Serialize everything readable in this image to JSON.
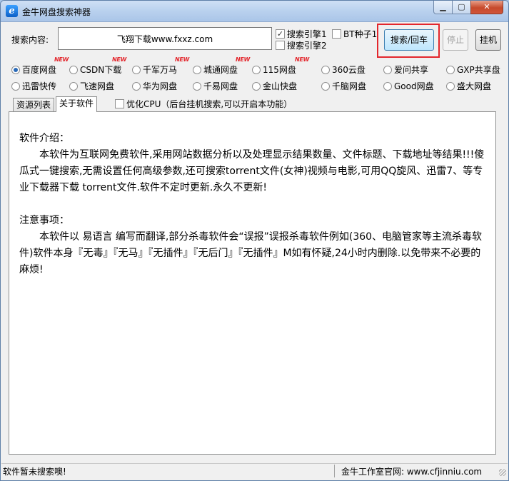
{
  "window": {
    "title": "金牛网盘搜索神器",
    "icon": "ie-logo-icon"
  },
  "search": {
    "label": "搜索内容:",
    "value": "飞翔下载www.fxxz.com",
    "engines": [
      {
        "label": "搜索引擎1",
        "checked": true
      },
      {
        "label": "搜索引擎2",
        "checked": false
      },
      {
        "label": "BT种子1",
        "checked": false
      }
    ],
    "buttons": {
      "search": "搜索/回车",
      "stop": "停止",
      "hangup": "挂机"
    },
    "highlight_color": "#e3262c"
  },
  "sources": {
    "new_badge": "NEW",
    "row1": [
      {
        "label": "百度网盘",
        "selected": true,
        "is_new": true
      },
      {
        "label": "CSDN下载",
        "selected": false,
        "is_new": true
      },
      {
        "label": "千军万马",
        "selected": false,
        "is_new": true
      },
      {
        "label": "城通网盘",
        "selected": false,
        "is_new": true
      },
      {
        "label": "115网盘",
        "selected": false,
        "is_new": true
      },
      {
        "label": "360云盘",
        "selected": false,
        "is_new": false
      },
      {
        "label": "爱问共享",
        "selected": false,
        "is_new": false
      },
      {
        "label": "GXP共享盘",
        "selected": false,
        "is_new": false
      }
    ],
    "row2": [
      {
        "label": "迅雷快传",
        "selected": false
      },
      {
        "label": "飞速网盘",
        "selected": false
      },
      {
        "label": "华为网盘",
        "selected": false
      },
      {
        "label": "千易网盘",
        "selected": false
      },
      {
        "label": "金山快盘",
        "selected": false
      },
      {
        "label": "千脑网盘",
        "selected": false
      },
      {
        "label": "Good网盘",
        "selected": false
      },
      {
        "label": "盛大网盘",
        "selected": false
      }
    ]
  },
  "tabs": [
    {
      "label": "资源列表",
      "active": false
    },
    {
      "label": "关于软件",
      "active": true
    }
  ],
  "optimize": {
    "label": "优化CPU（后台挂机搜索,可以开启本功能）",
    "checked": false
  },
  "about": {
    "intro_title": "软件介绍：",
    "intro_text": "本软件为互联网免费软件,采用网站数据分析以及处理显示结果数量、文件标题、下载地址等结果!!!傻瓜式一键搜索,无需设置任何高级参数,还可搜索torrent文件(女神)视频与电影,可用QQ旋风、迅雷7、等专业下载器下载 torrent文件.软件不定时更新.永久不更新!",
    "notes_title": "注意事项：",
    "notes_text": "本软件以 易语言 编写而翻译,部分杀毒软件会“误报”误报杀毒软件例如(360、电脑管家等主流杀毒软件)软件本身『无毒』『无马』『无插件』『无后门』『无插件』M如有怀疑,24小时内删除.以免带来不必要的麻烦!"
  },
  "status": {
    "left": "软件暂未搜索噢!",
    "right": "金牛工作室官网: www.cfjinniu.com"
  }
}
